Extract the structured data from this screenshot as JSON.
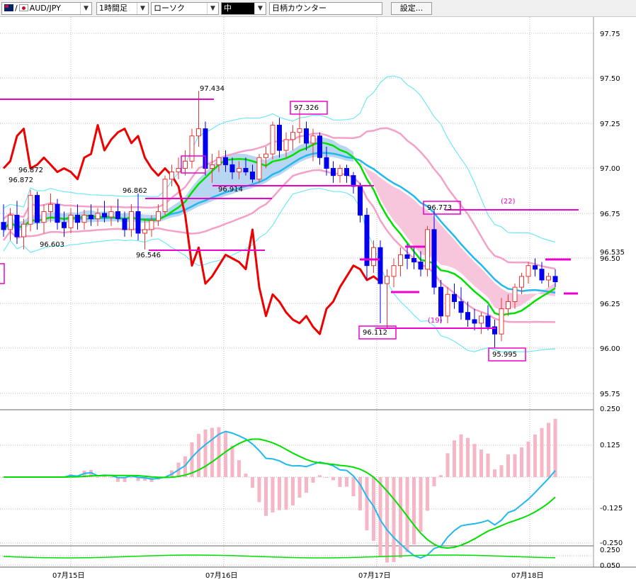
{
  "toolbar": {
    "pair": "AUD/JPY",
    "timeframe": "1時間足",
    "chart_style": "ローソク",
    "line_width": "中",
    "counter": "日柄カウンター",
    "settings": "設定..."
  },
  "colors": {
    "ichimoku_cloud": "#b8d6f2",
    "cloud_bear": "#f7c6dd",
    "ma_short": "#00e000",
    "ma_long": "#20b8f0",
    "bb_outer": "#70e8f8",
    "bb_inner": "#f4a0c8",
    "chikou": "#ee0000",
    "annotation": "#ee00cc",
    "bull_candle": "#ee3333",
    "bear_candle": "#0000ee"
  },
  "chart_data": [
    {
      "type": "candlestick",
      "symbol": "AUD/JPY",
      "timeframe": "1時間足",
      "x_ticks": [
        "07月15日",
        "07月16日",
        "07月17日",
        "07月18日"
      ],
      "y_ticks": [
        "97.75",
        "97.50",
        "97.25",
        "97.00",
        "96.75",
        "96.50",
        "96.25",
        "96.00",
        "95.75"
      ],
      "ylim": [
        95.75,
        97.75
      ],
      "current_price": "96.535",
      "annotations": [
        "96.872",
        "96.872",
        "96.603",
        "96.862",
        "96.546",
        "97.434",
        "96.914",
        "97.326",
        "96.773",
        "96.112",
        "95.995",
        "(22)",
        "(19)"
      ],
      "candles_ohlc": [
        [
          96.7,
          96.8,
          96.62,
          96.66
        ],
        [
          96.66,
          96.78,
          96.6,
          96.74
        ],
        [
          96.74,
          96.82,
          96.58,
          96.62
        ],
        [
          96.62,
          96.72,
          96.55,
          96.69
        ],
        [
          96.69,
          96.88,
          96.65,
          96.85
        ],
        [
          96.85,
          96.87,
          96.66,
          96.7
        ],
        [
          96.7,
          96.8,
          96.64,
          96.76
        ],
        [
          96.76,
          96.86,
          96.7,
          96.8
        ],
        [
          96.8,
          96.83,
          96.66,
          96.7
        ],
        [
          96.7,
          96.76,
          96.62,
          96.67
        ],
        [
          96.67,
          96.78,
          96.64,
          96.74
        ],
        [
          96.74,
          96.8,
          96.66,
          96.7
        ],
        [
          96.7,
          96.77,
          96.66,
          96.74
        ],
        [
          96.74,
          96.8,
          96.68,
          96.72
        ],
        [
          96.72,
          96.78,
          96.68,
          96.75
        ],
        [
          96.75,
          96.82,
          96.7,
          96.73
        ],
        [
          96.73,
          96.79,
          96.68,
          96.76
        ],
        [
          96.76,
          96.83,
          96.7,
          96.72
        ],
        [
          96.72,
          96.76,
          96.62,
          96.66
        ],
        [
          96.66,
          96.8,
          96.62,
          96.76
        ],
        [
          96.76,
          96.86,
          96.6,
          96.64
        ],
        [
          96.64,
          96.72,
          96.55,
          96.66
        ],
        [
          96.66,
          96.74,
          96.62,
          96.71
        ],
        [
          96.71,
          96.8,
          96.68,
          96.76
        ],
        [
          96.76,
          96.96,
          96.74,
          96.94
        ],
        [
          96.94,
          97.02,
          96.9,
          96.98
        ],
        [
          96.98,
          97.06,
          96.94,
          97.0
        ],
        [
          97.0,
          97.1,
          96.96,
          97.04
        ],
        [
          97.04,
          97.22,
          97.0,
          97.18
        ],
        [
          97.18,
          97.43,
          97.12,
          97.22
        ],
        [
          97.22,
          97.26,
          96.96,
          97.0
        ],
        [
          97.0,
          97.08,
          96.92,
          97.02
        ],
        [
          97.02,
          97.1,
          96.98,
          97.06
        ],
        [
          97.06,
          97.1,
          96.98,
          97.02
        ],
        [
          97.02,
          97.06,
          96.94,
          96.98
        ],
        [
          96.98,
          97.04,
          96.94,
          97.0
        ],
        [
          97.0,
          97.06,
          96.96,
          96.98
        ],
        [
          96.98,
          97.02,
          96.92,
          96.94
        ],
        [
          96.94,
          97.08,
          96.92,
          97.06
        ],
        [
          97.06,
          97.12,
          97.0,
          97.08
        ],
        [
          97.08,
          97.26,
          97.05,
          97.24
        ],
        [
          97.24,
          97.28,
          97.06,
          97.1
        ],
        [
          97.1,
          97.2,
          97.06,
          97.16
        ],
        [
          97.16,
          97.24,
          97.1,
          97.2
        ],
        [
          97.2,
          97.33,
          97.14,
          97.22
        ],
        [
          97.22,
          97.26,
          97.1,
          97.14
        ],
        [
          97.14,
          97.22,
          97.04,
          97.18
        ],
        [
          97.18,
          97.2,
          97.02,
          97.06
        ],
        [
          97.06,
          97.12,
          96.96,
          97.0
        ],
        [
          97.0,
          97.04,
          96.92,
          96.96
        ],
        [
          96.96,
          97.02,
          96.92,
          97.0
        ],
        [
          97.0,
          97.02,
          96.92,
          96.96
        ],
        [
          96.96,
          96.98,
          96.86,
          96.9
        ],
        [
          96.9,
          96.92,
          96.7,
          96.74
        ],
        [
          96.74,
          96.78,
          96.38,
          96.46
        ],
        [
          96.46,
          96.6,
          96.42,
          96.56
        ],
        [
          96.56,
          96.6,
          96.14,
          96.36
        ],
        [
          96.36,
          96.44,
          96.11,
          96.4
        ],
        [
          96.4,
          96.5,
          96.34,
          96.46
        ],
        [
          96.46,
          96.56,
          96.4,
          96.52
        ],
        [
          96.52,
          96.58,
          96.44,
          96.5
        ],
        [
          96.5,
          96.56,
          96.44,
          96.48
        ],
        [
          96.48,
          96.54,
          96.4,
          96.44
        ],
        [
          96.44,
          96.68,
          96.4,
          96.66
        ],
        [
          96.66,
          96.77,
          96.3,
          96.34
        ],
        [
          96.34,
          96.38,
          96.14,
          96.18
        ],
        [
          96.18,
          96.34,
          96.14,
          96.3
        ],
        [
          96.3,
          96.36,
          96.22,
          96.26
        ],
        [
          96.26,
          96.34,
          96.16,
          96.2
        ],
        [
          96.2,
          96.26,
          96.12,
          96.16
        ],
        [
          96.16,
          96.22,
          96.1,
          96.14
        ],
        [
          96.14,
          96.2,
          96.08,
          96.18
        ],
        [
          96.18,
          96.24,
          96.1,
          96.12
        ],
        [
          96.12,
          96.16,
          96.0,
          96.08
        ],
        [
          96.08,
          96.28,
          96.04,
          96.22
        ],
        [
          96.22,
          96.3,
          96.18,
          96.26
        ],
        [
          96.26,
          96.36,
          96.22,
          96.34
        ],
        [
          96.34,
          96.42,
          96.3,
          96.4
        ],
        [
          96.4,
          96.48,
          96.36,
          96.46
        ],
        [
          96.46,
          96.5,
          96.4,
          96.44
        ],
        [
          96.44,
          96.48,
          96.36,
          96.38
        ],
        [
          96.38,
          96.42,
          96.34,
          96.4
        ],
        [
          96.4,
          96.44,
          96.34,
          96.37
        ]
      ]
    },
    {
      "type": "line",
      "name": "macd",
      "y_ticks": [
        "0.250",
        "0.125",
        "-0.125",
        "-0.250"
      ],
      "ylim": [
        -0.25,
        0.25
      ]
    },
    {
      "type": "line",
      "name": "sub",
      "y_ticks": [
        "0.250",
        "0.050"
      ]
    }
  ]
}
